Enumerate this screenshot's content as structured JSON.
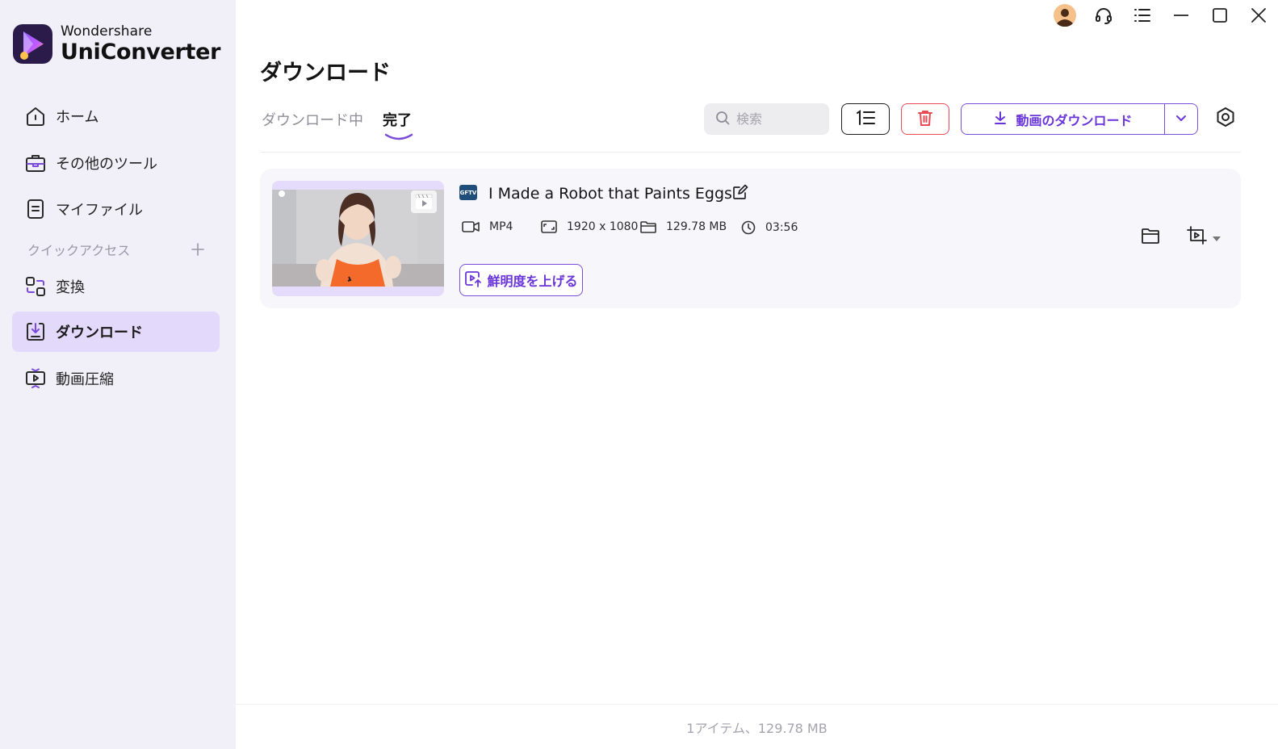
{
  "app": {
    "brand": "Wondershare",
    "product": "UniConverter"
  },
  "sidebar": {
    "items": [
      {
        "label": "ホーム",
        "icon": "home-icon"
      },
      {
        "label": "その他のツール",
        "icon": "toolbox-icon"
      },
      {
        "label": "マイファイル",
        "icon": "file-icon"
      },
      {
        "label": "変換",
        "icon": "convert-icon"
      },
      {
        "label": "ダウンロード",
        "icon": "download-icon",
        "active": true
      },
      {
        "label": "動画圧縮",
        "icon": "compress-icon"
      }
    ],
    "quick_access_label": "クイックアクセス"
  },
  "page": {
    "title": "ダウンロード"
  },
  "tabs": {
    "downloading": "ダウンロード中",
    "done": "完了",
    "active": "done"
  },
  "toolbar": {
    "search_placeholder": "検索",
    "download_label": "動画のダウンロード"
  },
  "item": {
    "title": "I Made a Robot that Paints Eggs",
    "source_badge": "GFTV",
    "format": "MP4",
    "resolution": "1920 x 1080",
    "size": "129.78 MB",
    "duration": "03:56",
    "enhance_label": "鮮明度を上げる"
  },
  "footer": {
    "summary": "1アイテム、129.78 MB"
  },
  "colors": {
    "accent": "#6a35d8",
    "sidebar_bg": "#f1eff8",
    "active_bg": "#e3d9fb",
    "delete": "#ea4a53"
  }
}
